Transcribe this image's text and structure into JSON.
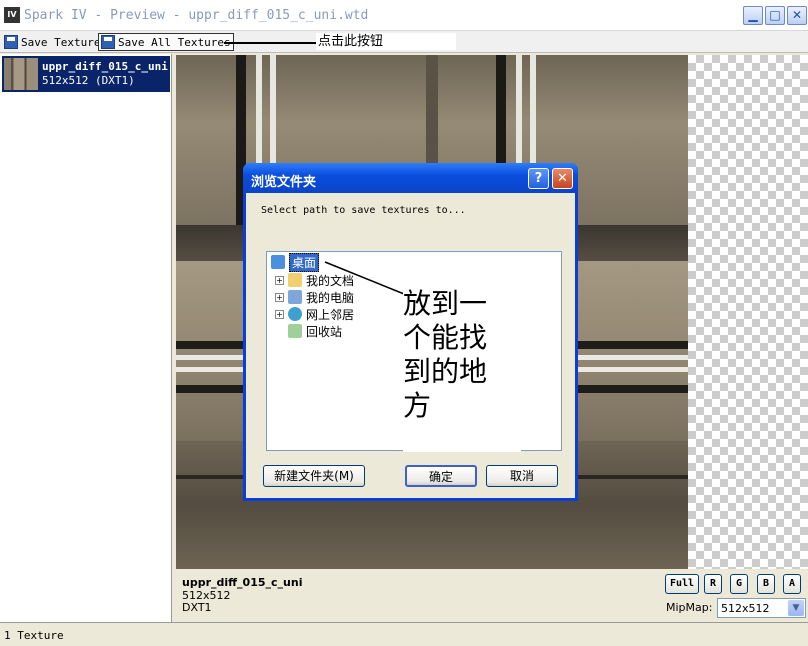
{
  "window": {
    "title": "Spark IV - Preview - uppr_diff_015_c_uni.wtd",
    "icon_text": "IV",
    "controls": [
      "minimize-icon",
      "maximize-icon",
      "close-icon"
    ]
  },
  "toolbar": {
    "save_texture": "Save Texture",
    "save_all": "Save All Textures",
    "annotation": "点击此按钮"
  },
  "texture_list": {
    "items": [
      {
        "name": "uppr_diff_015_c_uni",
        "info": "512x512 (DXT1)"
      }
    ]
  },
  "info": {
    "name": "uppr_diff_015_c_uni",
    "size": "512x512",
    "format": "DXT1",
    "channels": [
      "Full",
      "R",
      "G",
      "B",
      "A"
    ],
    "mipmap_label": "MipMap:",
    "mipmap_value": "512x512"
  },
  "status": {
    "text": "1 Texture"
  },
  "dialog": {
    "title": "浏览文件夹",
    "prompt": "Select path to save textures to...",
    "tree": [
      {
        "label": "桌面",
        "selected": true,
        "icon": "desktop-icon"
      },
      {
        "label": "我的文档",
        "icon": "documents-folder-icon"
      },
      {
        "label": "我的电脑",
        "icon": "computer-icon"
      },
      {
        "label": "网上邻居",
        "icon": "network-icon"
      },
      {
        "label": "回收站",
        "icon": "recycle-bin-icon"
      }
    ],
    "annotation_lines": [
      "放到一",
      "个能找",
      "到的地",
      "方"
    ],
    "new_folder": "新建文件夹(M)",
    "ok": "确定",
    "cancel": "取消",
    "help": "?"
  },
  "colors": {
    "selection": "#0a246a",
    "dialog_title": "#0a4ede",
    "tree_selection": "#316ac5"
  }
}
